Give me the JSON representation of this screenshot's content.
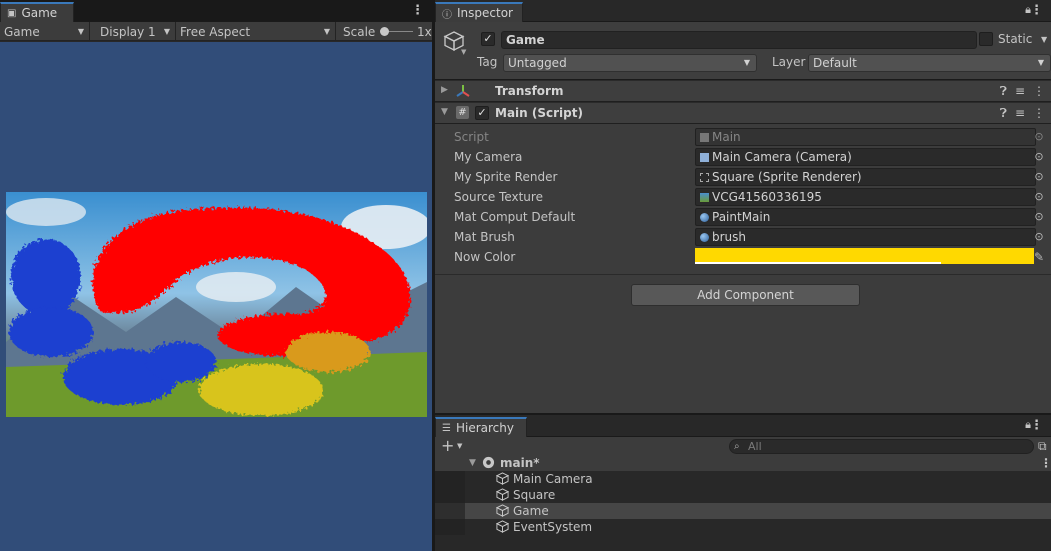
{
  "game": {
    "tab_label": "Game",
    "toolbar": {
      "view_mode": "Game",
      "display": "Display 1",
      "aspect": "Free Aspect",
      "scale_label": "Scale",
      "scale_value": "1x"
    }
  },
  "inspector": {
    "tab_label": "Inspector",
    "object_name": "Game",
    "active": true,
    "static_label": "Static",
    "tag_label": "Tag",
    "tag_value": "Untagged",
    "layer_label": "Layer",
    "layer_value": "Default",
    "components": {
      "transform": {
        "title": "Transform"
      },
      "main_script": {
        "title": "Main (Script)",
        "enabled": true,
        "properties": [
          {
            "label": "Script",
            "value": "Main",
            "icon": "script-icon",
            "disabled": true
          },
          {
            "label": "My Camera",
            "value": "Main Camera (Camera)",
            "icon": "camera-icon"
          },
          {
            "label": "My Sprite Render",
            "value": "Square (Sprite Renderer)",
            "icon": "sprite-renderer-icon"
          },
          {
            "label": "Source Texture",
            "value": "VCG41560336195",
            "icon": "texture-icon"
          },
          {
            "label": "Mat Comput Default",
            "value": "PaintMain",
            "icon": "material-icon"
          },
          {
            "label": "Mat Brush",
            "value": "brush",
            "icon": "material-icon"
          }
        ],
        "color_label": "Now Color",
        "color_value": "#ffd900"
      }
    },
    "add_component_label": "Add Component"
  },
  "hierarchy": {
    "tab_label": "Hierarchy",
    "search_placeholder": "All",
    "scene_name": "main*",
    "items": [
      {
        "name": "Main Camera",
        "selected": false
      },
      {
        "name": "Square",
        "selected": false
      },
      {
        "name": "Game",
        "selected": true
      },
      {
        "name": "EventSystem",
        "selected": false
      }
    ]
  },
  "colors": {
    "accent": "#3a79bb",
    "game_background": "#314d79",
    "paint_red": "#ff0000",
    "paint_blue": "#1e3fd0",
    "paint_yellow": "#d8c41e"
  }
}
